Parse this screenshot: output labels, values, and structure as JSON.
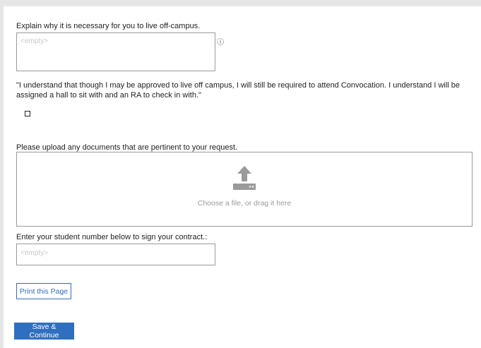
{
  "offcampus": {
    "question": "Explain why it is necessary for you to live off-campus.",
    "placeholder": "<empty>",
    "info_icon": "info-icon"
  },
  "convocation": {
    "statement": "\"I understand that though I may be approved to live off campus, I will still be required to attend Convocation. I understand I will be assigned a hall to sit with and an RA to check in with.\"",
    "checked": false
  },
  "upload": {
    "label": "Please upload any documents that are pertinent to your request.",
    "drop_text": "Choose a file, or drag it here",
    "icon": "upload-icon"
  },
  "student_number": {
    "label": "Enter your student number below to sign your contract.:",
    "placeholder": "<empty>"
  },
  "buttons": {
    "print": "Print this Page",
    "save": "Save & Continue"
  },
  "colors": {
    "accent": "#2f6fbf",
    "background": "#e6e6e6",
    "border": "#9a9a9a"
  }
}
